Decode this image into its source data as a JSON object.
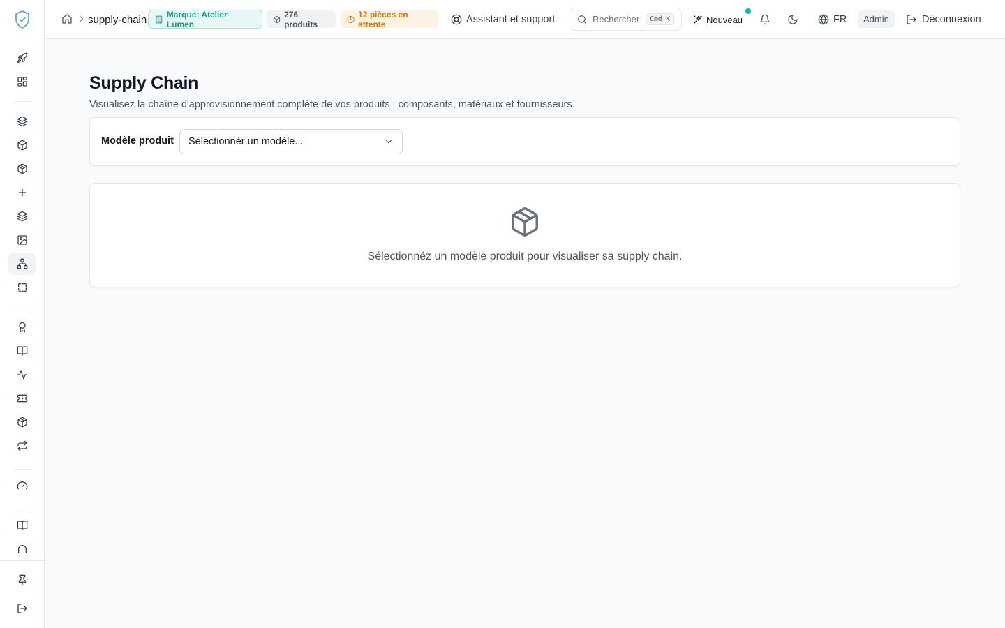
{
  "sidebar": {
    "icons": [
      "rocket-icon",
      "grid-icon",
      "layers-icon",
      "box-icon",
      "package-icon",
      "plus-icon",
      "layers-icon",
      "image-icon",
      "network-icon",
      "dashed-square-icon",
      "award-icon",
      "book-open-icon",
      "activity-icon",
      "ticket-icon",
      "package-icon",
      "repeat-icon",
      "gauge-icon",
      "book-open-icon",
      "arch-icon",
      "pin-icon",
      "log-out-icon"
    ],
    "active_item": "network-icon"
  },
  "breadcrumb": {
    "current": "supply-chain"
  },
  "badges": {
    "brand": "Marque: Atelier Lumen",
    "products": "276 produits",
    "pending": "12 pièces en attente"
  },
  "topbar": {
    "support_label": "Assistant et support",
    "search_placeholder": "Rechercher",
    "search_shortcut": "Cmd K",
    "new_label": "Nouveau",
    "language": "FR",
    "role": "Admin",
    "logout_label": "Déconnexion"
  },
  "page": {
    "title": "Supply Chain",
    "subtitle": "Visualisez la chaîne d'approvisionnement complète de vos produits : composants, matériaux et fournisseurs."
  },
  "filter": {
    "label": "Modèle produit",
    "select_value": "Sélectionnér un modèle..."
  },
  "empty_state": {
    "message": "Sélectionnéz un modèle produit pour visualiser sa supply chain."
  },
  "colors": {
    "accent": "#14b8a6",
    "brand_badge_text": "#169a8c",
    "pending_badge_text": "#d97706"
  }
}
